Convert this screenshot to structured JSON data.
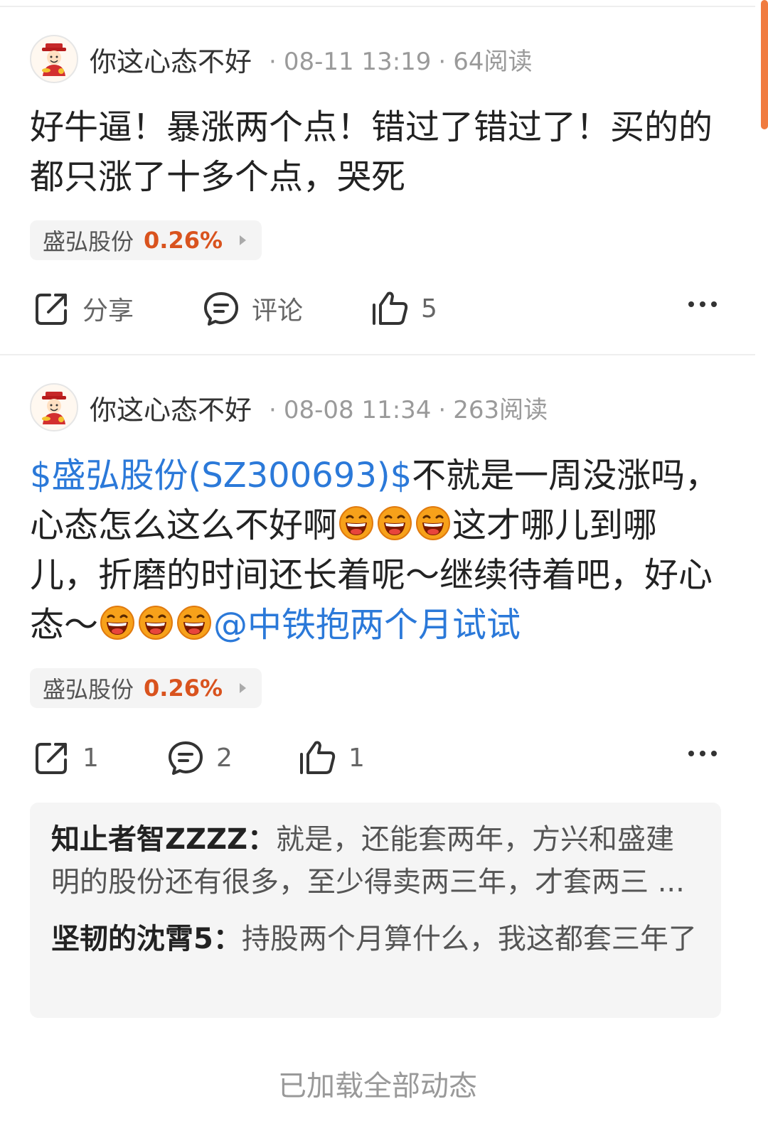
{
  "posts": [
    {
      "author": "你这心态不好",
      "time": "08-11 13:19",
      "reads": "64阅读",
      "body": "好牛逼！暴涨两个点！错过了错过了！买的的都只涨了十多个点，哭死",
      "stock": {
        "name": "盛弘股份",
        "change": "0.26%"
      },
      "actions": {
        "share": "分享",
        "comment": "评论",
        "like": "5"
      }
    },
    {
      "author": "你这心态不好",
      "time": "08-08 11:34",
      "reads": "263阅读",
      "body": {
        "stock_tag": "$盛弘股份(SZ300693)$",
        "text1": "不就是一周没涨吗，心态怎么这么不好啊",
        "text2": "这才哪儿到哪儿，折磨的时间还长着呢～继续待着吧，好心态～",
        "mention": "@中铁抱两个月试试",
        "emoji_name": "laughing-emoji"
      },
      "stock": {
        "name": "盛弘股份",
        "change": "0.26%"
      },
      "actions": {
        "share": "1",
        "comment": "2",
        "like": "1"
      },
      "replies": [
        {
          "author": "知止者智ZZZZ：",
          "text": "就是，还能套两年，方兴和盛建明的股份还有很多，至少得卖两三年，才套两三 ..."
        },
        {
          "author": "坚韧的沈霄5：",
          "text": "持股两个月算什么，我这都套三年了"
        }
      ]
    }
  ],
  "footer": "已加载全部动态",
  "colors": {
    "link": "#2b79d9",
    "stock_change": "#d9531e",
    "scroll_indicator": "#f07b3f"
  }
}
